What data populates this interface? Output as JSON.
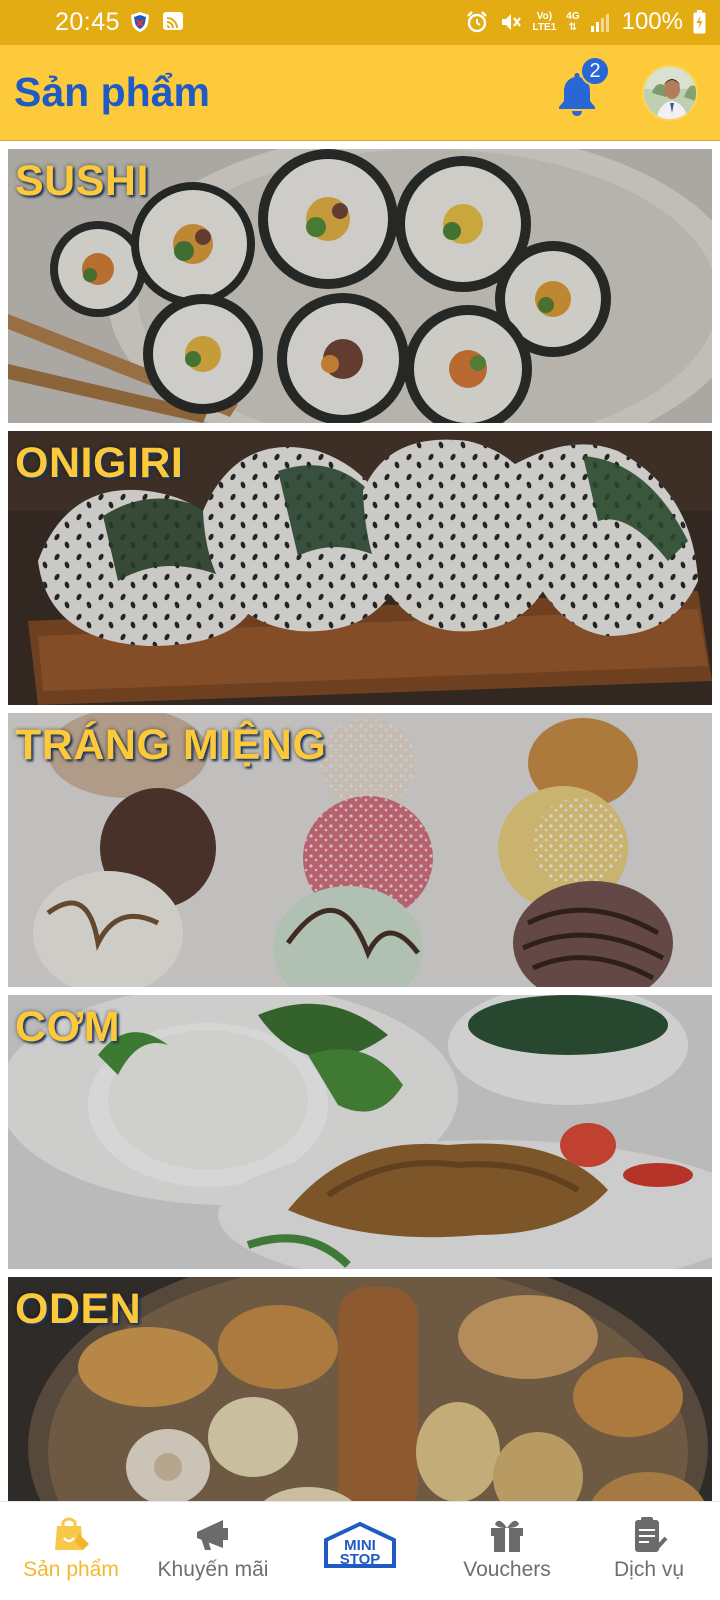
{
  "status_bar": {
    "time": "20:45",
    "battery": "100%",
    "network": "4G",
    "lte_line1": "Vo)",
    "lte_line2": "LTE1",
    "icons": [
      "shield-app-icon",
      "cast-icon",
      "alarm-icon",
      "mute-icon",
      "volte-icon",
      "signal-icon",
      "battery-charging-icon"
    ]
  },
  "header": {
    "title": "Sản phẩm",
    "notification_count": "2",
    "icons": [
      "bell-icon",
      "avatar"
    ]
  },
  "categories": [
    {
      "label": "SUSHI",
      "image": "sushi-image"
    },
    {
      "label": "ONIGIRI",
      "image": "onigiri-image"
    },
    {
      "label": "TRÁNG MIỆNG",
      "image": "dessert-image"
    },
    {
      "label": "CƠM",
      "image": "rice-image"
    },
    {
      "label": "ODEN",
      "image": "oden-image"
    }
  ],
  "bottom_nav": {
    "items": [
      {
        "label": "Sản phẩm",
        "icon": "shopping-bag-icon",
        "active": true
      },
      {
        "label": "Khuyến mãi",
        "icon": "megaphone-icon",
        "active": false
      },
      {
        "label": "MINI STOP",
        "icon": "ministop-logo",
        "active": false
      },
      {
        "label": "Vouchers",
        "icon": "gift-icon",
        "active": false
      },
      {
        "label": "Dịch vụ",
        "icon": "clipboard-check-icon",
        "active": false
      }
    ]
  },
  "colors": {
    "status_bar": "#e3ac12",
    "header_bg": "#fdca3b",
    "title_blue": "#1f5bc3",
    "label_yellow": "#fcc93a",
    "active_nav": "#f3b92d",
    "inactive_nav": "#6e6e6e"
  }
}
